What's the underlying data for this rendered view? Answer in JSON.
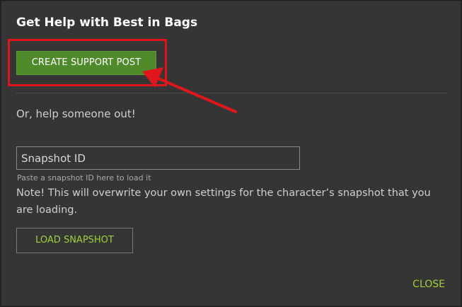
{
  "dialog": {
    "title": "Get Help with Best in Bags",
    "create_button_label": "CREATE SUPPORT POST",
    "help_text": "Or, help someone out!",
    "snapshot_input": {
      "placeholder": "Snapshot ID",
      "value": ""
    },
    "snapshot_hint": "Paste a snapshot ID here to load it",
    "note": "Note! This will overwrite your own settings for the character’s snapshot that you are loading.",
    "load_button_label": "LOAD SNAPSHOT",
    "close_label": "CLOSE"
  },
  "colors": {
    "background": "#353535",
    "primary_button": "#4f8a2b",
    "accent_text": "#9fd13a",
    "annotation": "#e0161d"
  }
}
